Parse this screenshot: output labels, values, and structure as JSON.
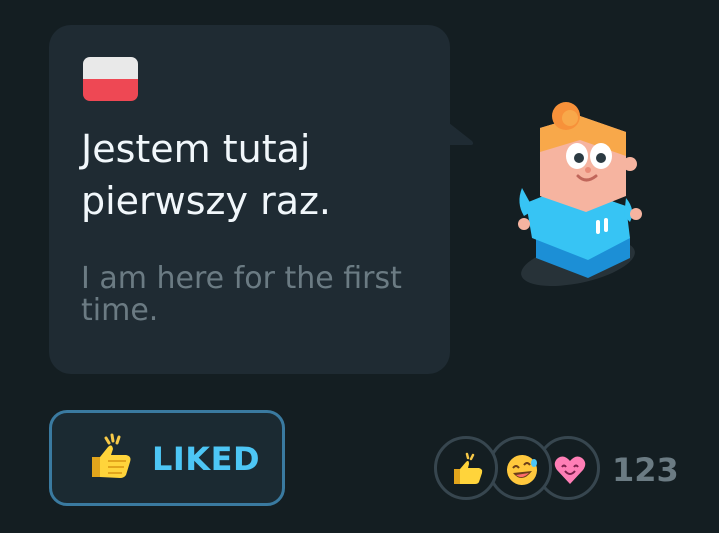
{
  "post": {
    "flag": "poland-flag-icon",
    "sentence": "Jestem tutaj pierwszy raz.",
    "translation": "I am here for the first time."
  },
  "character": "duolingo-character-icon",
  "actions": {
    "liked_label": "LIKED",
    "liked_icon": "thumbs-up-icon"
  },
  "reactions": {
    "icons": [
      "thumbs-up-icon",
      "laughing-emoji-icon",
      "heart-face-icon"
    ],
    "count": "123"
  },
  "colors": {
    "background": "#141e22",
    "bubble": "#1f2b33",
    "accent": "#4dc6f5",
    "flag_red": "#ee4854",
    "muted_text": "#6b7b83"
  }
}
